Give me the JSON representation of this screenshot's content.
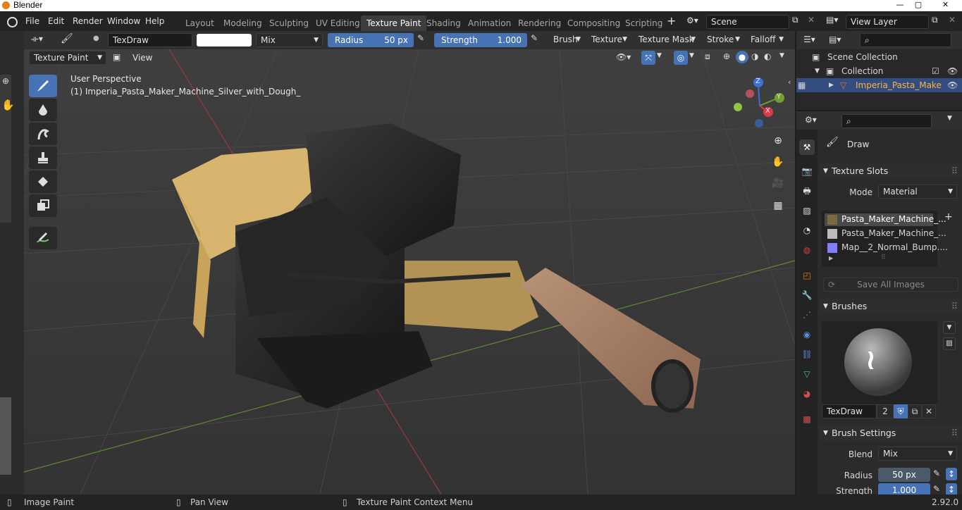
{
  "window": {
    "title": "Blender",
    "version": "2.92.0"
  },
  "menu": [
    "File",
    "Edit",
    "Render",
    "Window",
    "Help"
  ],
  "workspaces": [
    "Layout",
    "Modeling",
    "Sculpting",
    "UV Editing",
    "Texture Paint",
    "Shading",
    "Animation",
    "Rendering",
    "Compositing",
    "Scripting"
  ],
  "active_workspace": "Texture Paint",
  "scene": {
    "name": "Scene",
    "view_layer": "View Layer"
  },
  "tool_header": {
    "brush_name": "TexDraw",
    "blend": "Mix",
    "radius_label": "Radius",
    "radius_value": "50 px",
    "strength_label": "Strength",
    "strength_value": "1.000",
    "menus": [
      "Brush",
      "Texture",
      "Texture Mask",
      "Stroke",
      "Falloff"
    ]
  },
  "viewport": {
    "mode": "Texture Paint",
    "view_menu": "View",
    "perspective": "User Perspective",
    "object_info": "(1) Imperia_Pasta_Maker_Machine_Silver_with_Dough_",
    "gizmo_axes": [
      "Z",
      "Y",
      "X"
    ]
  },
  "outliner": {
    "scene_collection": "Scene Collection",
    "collection": "Collection",
    "object": "Imperia_Pasta_Make"
  },
  "properties": {
    "tool_name": "Draw",
    "texture_slots": {
      "title": "Texture Slots",
      "mode_label": "Mode",
      "mode_value": "Material",
      "slots": [
        "Pasta_Maker_Machine_...",
        "Pasta_Maker_Machine_...",
        "Map__2_Normal_Bump...."
      ],
      "save_all": "Save All Images"
    },
    "brushes": {
      "title": "Brushes",
      "brush_name": "TexDraw",
      "users": "2"
    },
    "brush_settings": {
      "title": "Brush Settings",
      "blend_label": "Blend",
      "blend_value": "Mix",
      "radius_label": "Radius",
      "radius_value": "50 px",
      "strength_label": "Strength",
      "strength_value": "1.000"
    }
  },
  "statusbar": {
    "left": "Image Paint",
    "middle": "Pan View",
    "right": "Texture Paint Context Menu"
  }
}
